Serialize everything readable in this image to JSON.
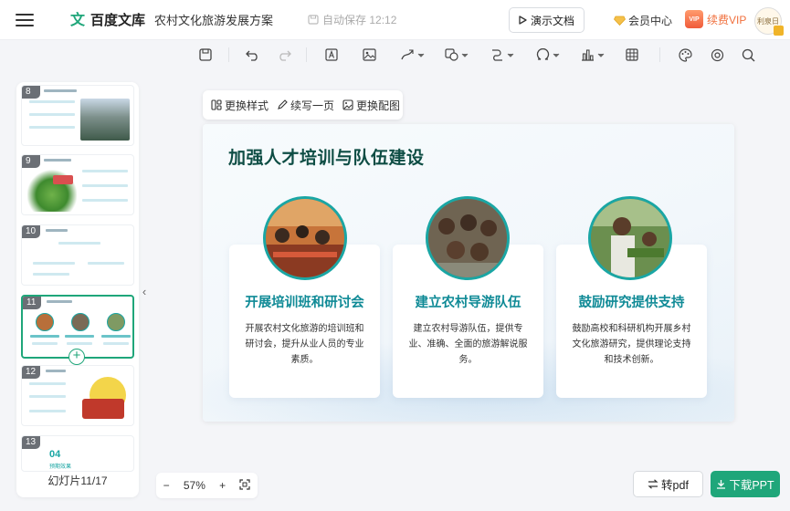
{
  "header": {
    "logo_text": "百度文库",
    "doc_title": "农村文化旅游发展方案",
    "autosave": "自动保存 12:12",
    "present_label": "演示文档",
    "member_label": "会员中心",
    "vip_label": "续费VIP",
    "vip_badge": "VIP",
    "avatar_text": "利泉日"
  },
  "toolbar": {
    "icons": [
      "save-icon",
      "undo-icon",
      "redo-icon",
      "text-box-icon",
      "image-icon",
      "pen-icon",
      "shape-icon",
      "connector-icon",
      "symbol-icon",
      "chart-icon",
      "table-icon",
      "palette-icon",
      "settings-icon",
      "search-icon"
    ]
  },
  "context_toolbar": {
    "change_style": "更换样式",
    "continue_page": "续写一页",
    "change_image": "更换配图"
  },
  "slides_panel": {
    "thumbs": [
      {
        "num": "8",
        "title": "打造农村文化旅游品牌"
      },
      {
        "num": "9",
        "title": "完善基础设施"
      },
      {
        "num": "10",
        "title": "加强农村营销"
      },
      {
        "num": "11",
        "title": "加强人才培训与队伍建设"
      },
      {
        "num": "12",
        "title": "加强政策支持"
      },
      {
        "num": "13",
        "big": "04",
        "sub": "预期效果"
      }
    ],
    "counter": "幻灯片11/17"
  },
  "slide": {
    "title": "加强人才培训与队伍建设",
    "cards": [
      {
        "title": "开展培训班和研讨会",
        "desc": "开展农村文化旅游的培训班和研讨会，提升从业人员的专业素质。"
      },
      {
        "title": "建立农村导游队伍",
        "desc": "建立农村导游队伍，提供专业、准确、全面的旅游解说服务。"
      },
      {
        "title": "鼓励研究提供支持",
        "desc": "鼓励高校和科研机构开展乡村文化旅游研究，提供理论支持和技术创新。"
      }
    ]
  },
  "bottom": {
    "zoom_minus": "−",
    "zoom_value": "57%",
    "zoom_plus": "+",
    "to_pdf": "转pdf",
    "download": "下载PPT"
  },
  "colors": {
    "accent": "#1fa67a",
    "title": "#0e4d44",
    "card_title": "#0f8a96"
  }
}
